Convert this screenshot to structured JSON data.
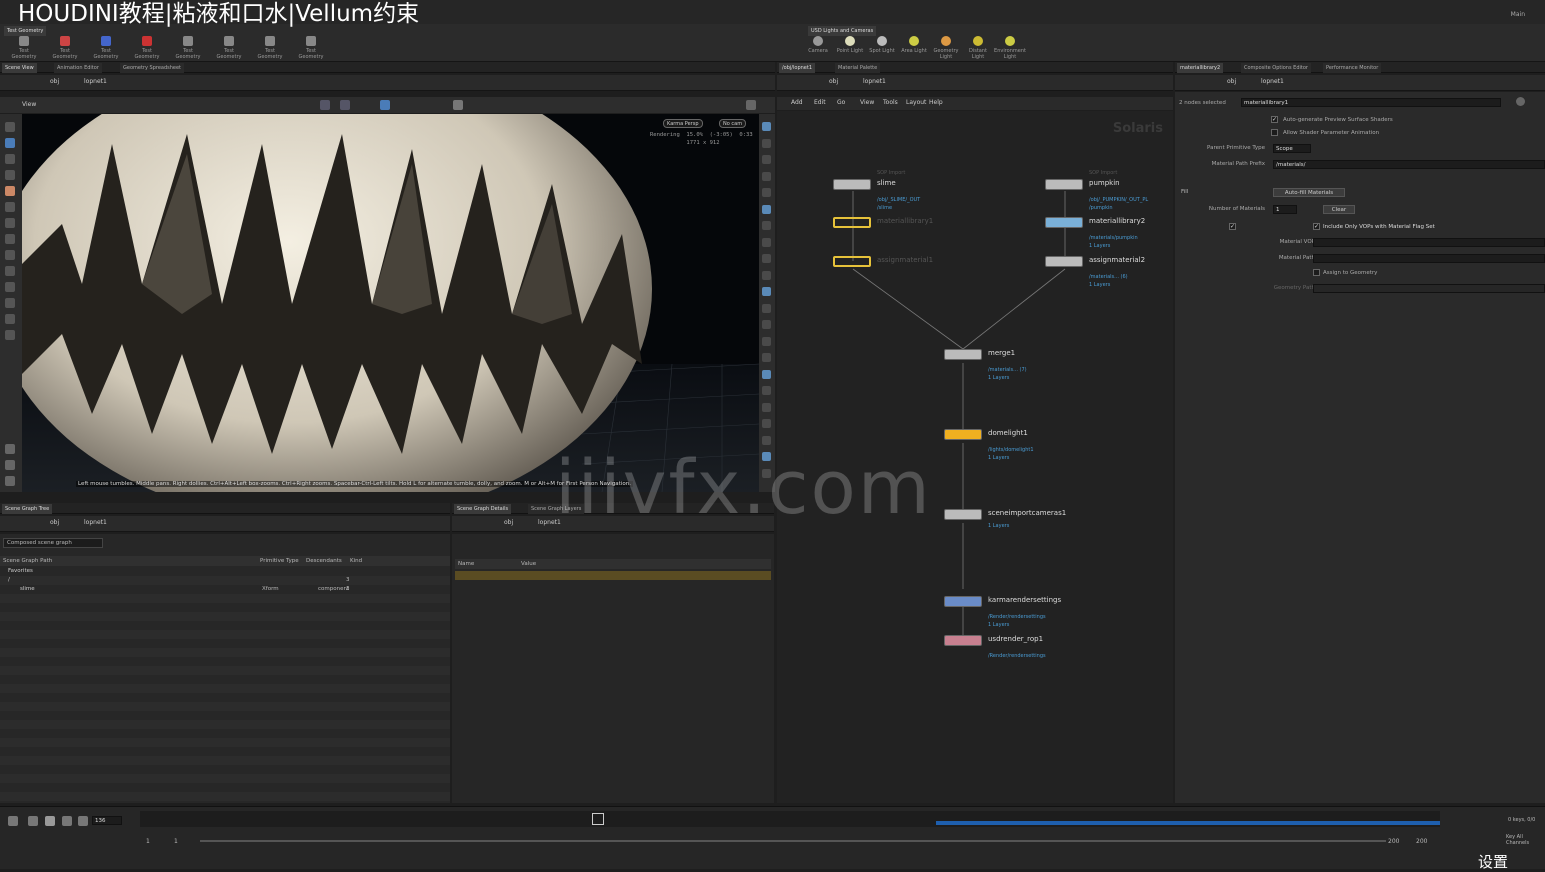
{
  "title": "HOUDINI教程|粘液和口水|Vellum约束",
  "top_right": "Main",
  "shelf": {
    "left_tab": "Test Geometry",
    "right_tab": "USD Lights and Cameras",
    "left_tools": [
      "Test Geometry",
      "Test Geometry",
      "Test Geometry",
      "Test Geometry",
      "Test Geometry",
      "Test Geometry",
      "Test Geometry",
      "Test Geometry"
    ],
    "right_tools": [
      "Camera",
      "Point Light",
      "Spot Light",
      "Area Light",
      "Geometry Light",
      "Distant Light",
      "Environment Light"
    ]
  },
  "left_tabs": [
    "Scene View",
    "Animation Editor",
    "Geometry Spreadsheet"
  ],
  "mid_tabs": [
    "/obj/lopnet1",
    "Material Palette"
  ],
  "right_tabs": [
    "materiallibrary2",
    "Composite Options Editor",
    "Performance Monitor"
  ],
  "path": {
    "obj": "obj",
    "net": "lopnet1"
  },
  "viewport": {
    "title": "View",
    "cam_persp": "Karma Persp",
    "cam_none": "No cam",
    "render_stats": "Rendering  15.0%  (-3:05)  0:33\n           1771 x 912",
    "hint": "Left mouse tumbles. Middle pans. Right dollies. Ctrl+Alt+Left box-zooms. Ctrl+Right zooms. Spacebar-Ctrl-Left tilts. Hold L for alternate tumble, dolly, and zoom.   M or Alt+M for First Person Navigation."
  },
  "sgt": {
    "tab": "Scene Graph Tree",
    "tab2": "Scene Graph Details",
    "tab3": "Scene Graph Layers",
    "mode": "Composed scene graph",
    "columns": [
      "Scene Graph Path",
      "Primitive Type",
      "Descendants",
      "Kind"
    ],
    "rows": [
      {
        "name": "Favorites",
        "type": "",
        "desc": "",
        "kind": ""
      },
      {
        "name": "/",
        "type": "",
        "desc": "3",
        "kind": ""
      },
      {
        "name": "slime",
        "type": "Xform",
        "desc": "3",
        "kind": "component"
      }
    ]
  },
  "sgd": {
    "name_col": "Name",
    "value_col": "Value"
  },
  "net": {
    "menu": [
      "Add",
      "Edit",
      "Go",
      "View",
      "Tools",
      "Layout",
      "Help"
    ],
    "context": "Solaris",
    "nodes": [
      {
        "name": "slime",
        "sub1": "/obj/_SLIME/_OUT",
        "sub2": "/slime",
        "top": "SOP Import"
      },
      {
        "name": "materiallibrary1",
        "sub1": "",
        "sub2": ""
      },
      {
        "name": "assignmaterial1",
        "sub1": "",
        "sub2": ""
      },
      {
        "name": "pumpkin",
        "sub1": "/obj/_PUMPKIN/_OUT_PL",
        "sub2": "/pumpkin",
        "top": "SOP Import"
      },
      {
        "name": "materiallibrary2",
        "sub1": "/materials/pumpkin",
        "sub2": "1 Layers"
      },
      {
        "name": "assignmaterial2",
        "sub1": "/materials... (6)",
        "sub2": "1 Layers"
      },
      {
        "name": "merge1",
        "sub1": "/materials... (7)",
        "sub2": "1 Layers"
      },
      {
        "name": "domelight1",
        "sub1": "/lights/domelight1",
        "sub2": "1 Layers"
      },
      {
        "name": "sceneimportcameras1",
        "sub1": "1 Layers",
        "sub2": ""
      },
      {
        "name": "karmarendersettings",
        "sub1": "/Render/rendersettings",
        "sub2": "1 Layers"
      },
      {
        "name": "usdrender_rop1",
        "sub1": "/Render/rendersettings",
        "sub2": ""
      }
    ]
  },
  "params": {
    "selected": "2 nodes selected",
    "node": "materiallibrary1",
    "auto_gen": "Auto-generate Preview Surface Shaders",
    "allow_anim": "Allow Shader Parameter Animation",
    "parent_prim_label": "Parent Primitive Type",
    "parent_prim_val": "Scope",
    "mat_prefix_label": "Material Path Prefix",
    "mat_prefix_val": "/materials/",
    "fill": "Fill",
    "auto_fill": "Auto-fill Materials",
    "num_mat_label": "Number of Materials",
    "num_mat_val": "1",
    "clear": "Clear",
    "include_vops": "Include Only VOPs with Material Flag Set",
    "mat_vop": "Material VOP",
    "mat_path": "Material Path",
    "assign_geo": "Assign to Geometry",
    "geo_path": "Geometry Path"
  },
  "timeline": {
    "frame": "136",
    "start": "1",
    "start2": "1",
    "end": "200",
    "end2": "200",
    "keys": "0 keys, 0/0",
    "key_all": "Key All Channels",
    "settings": "设置"
  },
  "watermark": "iiivfx.com"
}
